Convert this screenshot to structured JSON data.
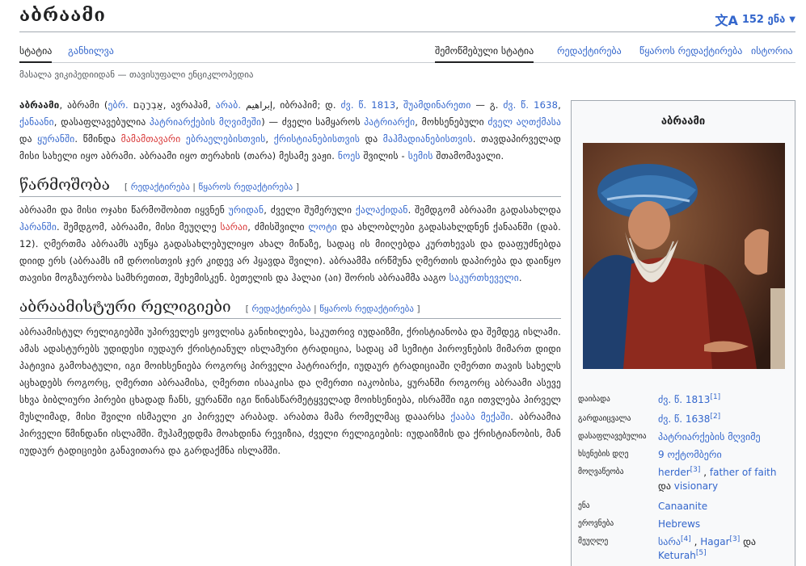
{
  "header": {
    "title": "აბრაამი",
    "lang_icon": "translate-icon",
    "lang_label": "152 ენა"
  },
  "tabs": {
    "article": "სტატია",
    "talk": "განხილვა",
    "reviewed": "შემოწმებული სტატია",
    "edit": "რედაქტირება",
    "edit_source": "წყაროს რედაქტირება",
    "history": "ისტორია"
  },
  "tagline": "მასალა ვიკიპედიიდან — თავისუფალი ენციკლოპედია",
  "intro": {
    "b0": "აბრაამი",
    "t1": ", აბრამი (",
    "l1": "ებრ.",
    "t2": " אַבְרָהָם, ავრაჰამ, ",
    "l2": "არაბ.",
    "t3": " إبراهيم, იბრაჰიმ; დ. ",
    "l3": "ძვ. წ.",
    "t3b": " ",
    "l4": "1813",
    "t4": ", ",
    "l5": "შუამდინარეთი",
    "t5": " — გ. ",
    "l6": "ძვ. წ.",
    "t6": " ",
    "l7": "1638",
    "t7": ", ",
    "l8": "ქანაანი",
    "t8": ", დასაფლავებულია ",
    "l9": "პატრიარქების მღვიმეში",
    "t9": ") — ძველი სამყაროს ",
    "l10": "პატრიარქი",
    "t10": ", მოხსენებული ",
    "l11": "ძველ აღთქმასა",
    "t11": " და ",
    "l12": "ყურანში",
    "t12": ". წმინდა ",
    "r1": "მამამთავარი",
    "t13": " ",
    "l13": "ებრაელებისთვის",
    "t14": ", ",
    "l14": "ქრისტიანებისთვის",
    "t15": " და ",
    "l15": "მაჰმადიანებისთვის",
    "t16": ". თავდაპირველად მისი სახელი იყო აბრამი. აბრაამი იყო თერახის (თარა) მესამე ვაჟი. ",
    "l16": "ნოეს",
    "t17": " შვილის - ",
    "l17": "სემის",
    "t18": " შთამომავალი."
  },
  "section1": {
    "heading": "წარმოშობა",
    "edit_open": "[ ",
    "edit": "რედაქტირება",
    "edit_sep": " | ",
    "edit_source": "წყაროს რედაქტირება",
    "edit_close": " ]",
    "t1": "აბრაამი და მისი ოჯახი წარმოშობით იყვნენ ",
    "l1": "ურიდან",
    "t2": ", ძველი შუმერული ",
    "l2": "ქალაქიდან",
    "t3": ". შემდგომ აბრაამი გადასახლდა ",
    "l3": "ჰარანში",
    "t4": ". შემდგომ, აბრაამი, მისი მეუღლე ",
    "l4": "სარაი",
    "t5": ", ძმისშვილი ",
    "l5": "ლოტი",
    "t6": " და ახლობლები გადასახლდნენ ქანაანში (დაბ. 12). ღმერთმა აბრაამს აუწყა გადასახლებულიყო ახალ მიწაზე, სადაც ის მიიღებდა კურთხევას და დააფუძნებდა დიიდ ერს (აბრაამს იმ დროისთვის ჯერ კიდევ არ ჰყავდა შვილი). აბრაამმა ირწმუნა ღმერთის დაპირება და დაიწყო თავისი მოგზაურობა სამხრეთით, შეხემისკენ. ბეთელის და ჰალაი (აი) შორის აბრაამმა ააგო ",
    "l6": "საკურთხეველი",
    "t7": "."
  },
  "section2": {
    "heading": "აბრაამისტური რელიგიები",
    "edit_open": "[ ",
    "edit": "რედაქტირება",
    "edit_sep": " | ",
    "edit_source": "წყაროს რედაქტირება",
    "edit_close": " ]",
    "t1": "აბრაამისტულ რელიგიებში უპირველეს ყოვლისა განიხილება, საკუთრივ იუდაიზმი, ქრისტიანობა და შემდეგ ისლამი. ამას ადასტურებს უდიდესი იუდაურ ქრისტიანულ ისლამური ტრადიცია, სადაც ამ სემიტი პიროვნების მიმართ დიდი პატივია გამოხატული, იგი მოიხსენიება როგორც პირველი პატრიარქი, იუდაურ ტრადიციაში ღმერთი თავის სახელს აცხადებს როგორც, ღმერთი აბრაამისა, ღმერთი ისააკისა და ღმერთი იაკობისა, ყურანში როგორც აბრაამი ასევე სხვა ბიბლიური პირები ცხადად ჩანს, ყურანში იგი წინასწარმეტყველად მოიხსენიება, ისრამში იგი ითვლება პირველ მუსლიმად, მისი შვილი ისმაელი კი პირველ არაბად. არაბთა მამა რომელმაც დააარსა ",
    "l1": "ქააბა",
    "t2": " ",
    "l2": "მექაში",
    "t3": ". აბრაამია პირველი წმინდანი ისლამში. მუჰამედდმა მოახდინა რევიზია, ძველი რელიგიების: იუდაიზმის და ქრისტიანობის, მან იუდაურ ტადიციები განავითარა და გარდაქმნა ისლამში."
  },
  "infobox": {
    "title": "აბრაამი",
    "image_alt": "აბრაამი",
    "rows": {
      "birth": {
        "label": "დაიბადა",
        "v1": "ძვ. წ. 1813",
        "s1": "[1]"
      },
      "death": {
        "label": "გარდაიცვალა",
        "v1": "ძვ. წ. 1638",
        "s1": "[2]"
      },
      "burial": {
        "label": "დასაფლავებულია",
        "v1": "პატრიარქების მღვიმე"
      },
      "feast": {
        "label": "ხსენების დღე",
        "v1": "9 ოქტომბერი"
      },
      "occupation": {
        "label": "მოღვაწეობა",
        "v1": "herder",
        "s1": "[3]",
        "sep1": " , ",
        "v2": "father of faith",
        "t1": " და ",
        "v3": "visionary"
      },
      "language": {
        "label": "ენა",
        "v1": "Canaanite"
      },
      "ethnic": {
        "label": "ეროვნება",
        "v1": "Hebrews"
      },
      "spouse": {
        "label": "მეუღლე",
        "v1": "სარა",
        "s1": "[4]",
        "sep1": " , ",
        "v2": "Hagar",
        "s2": "[3]",
        "t1": " და ",
        "v3": "Keturah",
        "s3": "[5]"
      }
    }
  }
}
